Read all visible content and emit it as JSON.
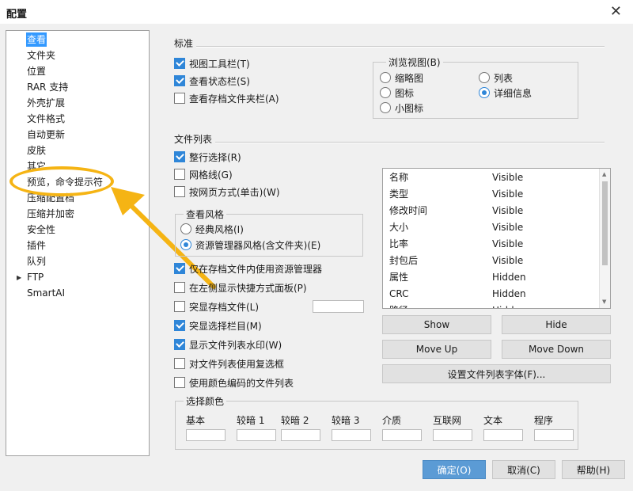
{
  "window": {
    "title": "配置",
    "close_glyph": "✕"
  },
  "nav": {
    "items": [
      {
        "label": "查看",
        "selected": true
      },
      {
        "label": "文件夹"
      },
      {
        "label": "位置"
      },
      {
        "label": "RAR 支持"
      },
      {
        "label": "外壳扩展"
      },
      {
        "label": "文件格式"
      },
      {
        "label": "自动更新"
      },
      {
        "label": "皮肤"
      },
      {
        "label": "其它"
      },
      {
        "label": "预览，命令提示符"
      },
      {
        "label": "压缩配置档"
      },
      {
        "label": "压缩并加密"
      },
      {
        "label": "安全性"
      },
      {
        "label": "插件"
      },
      {
        "label": "队列"
      },
      {
        "label": "FTP",
        "has_children": true
      },
      {
        "label": "SmartAI"
      }
    ],
    "expand_glyph": "▶"
  },
  "standard": {
    "title": "标准",
    "show_toolbar": {
      "label": "视图工具栏(T)",
      "checked": true
    },
    "show_statusbar": {
      "label": "查看状态栏(S)",
      "checked": true
    },
    "show_archive_folder_bar": {
      "label": "查看存档文件夹栏(A)",
      "checked": false
    },
    "browse_view": {
      "title": "浏览视图(B)",
      "options": [
        {
          "label": "缩略图",
          "selected": false
        },
        {
          "label": "列表",
          "selected": false
        },
        {
          "label": "图标",
          "selected": false
        },
        {
          "label": "详细信息",
          "selected": true
        },
        {
          "label": "小图标",
          "selected": false
        }
      ]
    }
  },
  "file_list": {
    "title": "文件列表",
    "full_row_select": {
      "label": "整行选择(R)",
      "checked": true
    },
    "grid_lines": {
      "label": "网格线(G)",
      "checked": false
    },
    "web_style": {
      "label": "按网页方式(单击)(W)",
      "checked": false
    },
    "view_style": {
      "title": "查看风格",
      "classic": {
        "label": "经典风格(I)",
        "selected": false
      },
      "explorer": {
        "label": "资源管理器风格(含文件夹)(E)",
        "selected": true
      }
    },
    "explorer_in_archive": {
      "label": "仅在存档文件内使用资源管理器",
      "checked": true
    },
    "left_shortcuts_panel": {
      "label": "在左侧显示快捷方式面板(P)",
      "checked": false
    },
    "highlight_archives": {
      "label": "突显存档文件(L)",
      "checked": false
    },
    "highlight_selected": {
      "label": "突显选择栏目(M)",
      "checked": true
    },
    "watermark": {
      "label": "显示文件列表水印(W)",
      "checked": true
    },
    "checkboxes": {
      "label": "对文件列表使用复选框",
      "checked": false
    },
    "color_coded": {
      "label": "使用颜色编码的文件列表",
      "checked": false
    }
  },
  "columns": {
    "rows": [
      {
        "name": "名称",
        "state": "Visible"
      },
      {
        "name": "类型",
        "state": "Visible"
      },
      {
        "name": "修改时间",
        "state": "Visible"
      },
      {
        "name": "大小",
        "state": "Visible"
      },
      {
        "name": "比率",
        "state": "Visible"
      },
      {
        "name": "封包后",
        "state": "Visible"
      },
      {
        "name": "属性",
        "state": "Hidden"
      },
      {
        "name": "CRC",
        "state": "Hidden"
      },
      {
        "name": "路径",
        "state": "Hidden"
      }
    ],
    "show_label": "Show",
    "hide_label": "Hide",
    "move_up_label": "Move Up",
    "move_down_label": "Move Down",
    "font_label": "设置文件列表字体(F)..."
  },
  "select_color": {
    "title": "选择颜色",
    "labels": [
      "基本",
      "较暗 1",
      "较暗 2",
      "较暗 3",
      "介质",
      "互联网",
      "文本",
      "程序"
    ]
  },
  "footer": {
    "ok_label": "确定(O)",
    "cancel_label": "取消(C)",
    "help_label": "帮助(H)"
  },
  "colors": {
    "accent": "#f5b414",
    "selection": "#3399ff",
    "check": "#2f86d8"
  }
}
